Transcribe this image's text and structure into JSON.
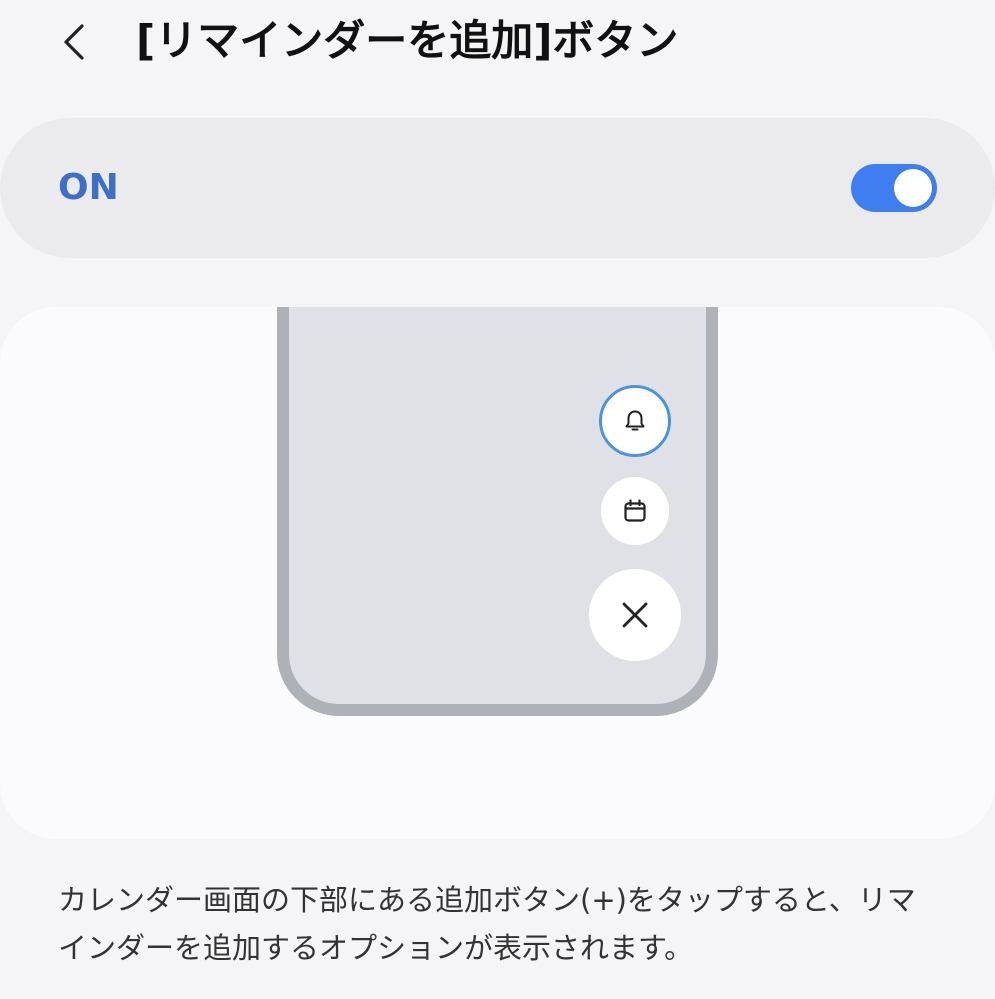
{
  "header": {
    "back_icon": "chevron-left-icon",
    "title": "[リマインダーを追加]ボタン"
  },
  "toggle": {
    "label": "ON",
    "state": "on",
    "accent_color": "#3f7ef0",
    "label_color": "#3e6fc6"
  },
  "preview": {
    "buttons": [
      {
        "icon": "bell-icon",
        "highlighted": true,
        "ring_color": "#4a94dc"
      },
      {
        "icon": "calendar-icon",
        "highlighted": false
      },
      {
        "icon": "close-icon",
        "highlighted": false
      }
    ]
  },
  "description": "カレンダー画面の下部にある追加ボタン(+)をタップすると、リマインダーを追加するオプションが表示されます。"
}
